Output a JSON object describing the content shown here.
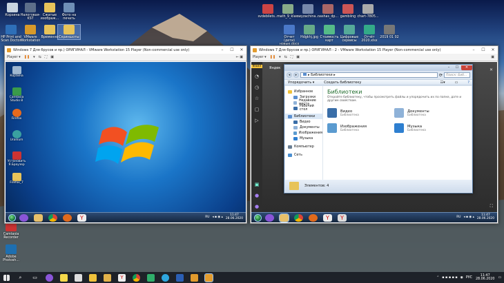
{
  "desktop": {
    "top_left": [
      {
        "label": "Корзина",
        "color": "#c8d4e0"
      },
      {
        "label": "Налоговая-KST",
        "color": "#5d6f8a"
      },
      {
        "label": "Сжатые изображ...",
        "color": "#e7c35a"
      },
      {
        "label": "Фото на печать",
        "color": "#6f8fb6"
      },
      {
        "label": "HP Print and Scan Doctor",
        "color": "#2e6fb8"
      },
      {
        "label": "VMware Workstation",
        "color": "#d89a2a"
      },
      {
        "label": "Временно",
        "color": "#e7c35a"
      },
      {
        "label": "Скриншоты",
        "color": "#e7c35a"
      }
    ],
    "top_right": [
      {
        "label": "svdebilets...",
        "color": "#c44"
      },
      {
        "label": "math_9_klas...",
        "color": "#8a8"
      },
      {
        "label": "neyzachina...",
        "color": "#78a"
      },
      {
        "label": "nashas_dp...",
        "color": "#a66"
      },
      {
        "label": "gambiing",
        "color": "#c55"
      },
      {
        "label": "chart-7805...",
        "color": "#aaa"
      },
      {
        "label": "Отчет (дети) новые.docx",
        "color": "#4a78c8"
      },
      {
        "label": "Hdgkhj.jpg",
        "color": "#6a8"
      },
      {
        "label": "Стоимость карт",
        "color": "#5b8"
      },
      {
        "label": "Цифровые сервисы",
        "color": "#5a9"
      },
      {
        "label": "Отчёт 2020.xlsx",
        "color": "#3a8"
      },
      {
        "label": "2019 01 02",
        "color": "#777"
      }
    ],
    "bottom_left": [
      {
        "label": "Camtasia Recorder",
        "color": "#c33"
      },
      {
        "label": "Adobe Photosh...",
        "color": "#1e6fb0"
      }
    ]
  },
  "vm_left": {
    "title": "Windows 7 Для брусов и пр.) ОРИГИНАЛ - VMware Workstation 15 Player (Non-commercial use only)",
    "player_menu": "Player ▾",
    "guest_icons": [
      {
        "label": "Корзина",
        "color": "#9fb8d0"
      },
      {
        "label": "Camtasia Studio 8",
        "color": "#3a9b4a"
      },
      {
        "label": "Firefox",
        "color": "#e86a1c"
      },
      {
        "label": "Uranium",
        "color": "#3aa0a0"
      },
      {
        "label": "Установить Я.Браузер",
        "color": "#c33"
      },
      {
        "label": "Firefox_7",
        "color": "#e7c35a"
      }
    ],
    "taskbar_icons": [
      {
        "name": "purple-icon",
        "color": "#8a55d8"
      },
      {
        "name": "explorer-icon",
        "color": "#e8c06a"
      },
      {
        "name": "chrome-icon",
        "color": "#e0a23a"
      },
      {
        "name": "firefox-icon",
        "color": "#e06a1c"
      },
      {
        "name": "yandex-icon",
        "color": "#eeeeee"
      }
    ],
    "lang": "RU",
    "time": "11:47",
    "date": "28.06.2020"
  },
  "vm_right": {
    "title": "Windows 7 Для брусов и пр.) ОРИГИНАЛ - 2 - VMware Workstation 15 Player (Non-commercial use only)",
    "player_menu": "Player ▾",
    "browser_label": "Яндек",
    "lang": "RU",
    "time": "11:47",
    "date": "28.06.2020",
    "explorer": {
      "address": "▸ Библиотеки ▸",
      "search_placeholder": "Поиск: Биб...",
      "cmd_organize": "Упорядочить ▾",
      "cmd_new_library": "Создать библиотеку",
      "nav": {
        "favorites": "Избранное",
        "downloads": "Загрузки",
        "recent": "Недавние места",
        "desktop": "Рабочий стол",
        "libraries": "Библиотеки",
        "video": "Видео",
        "documents": "Документы",
        "images": "Изображения",
        "music": "Музыка",
        "computer": "Компьютер",
        "network": "Сеть"
      },
      "heading": "Библиотеки",
      "description": "Откройте библиотеку, чтобы просмотреть файлы и упорядочить их по папке, дате и другим свойствам.",
      "libraries": [
        {
          "name": "Видео",
          "type": "Библиотека",
          "color": "#3a6ea8"
        },
        {
          "name": "Документы",
          "type": "Библиотека",
          "color": "#8fb2d8"
        },
        {
          "name": "Изображения",
          "type": "Библиотека",
          "color": "#5b9bd0"
        },
        {
          "name": "Музыка",
          "type": "Библиотека",
          "color": "#2e7fd0"
        }
      ],
      "status": "Элементов: 4"
    },
    "taskbar_icons": [
      {
        "name": "purple-icon",
        "color": "#8a55d8"
      },
      {
        "name": "explorer-icon",
        "color": "#e8c06a"
      },
      {
        "name": "chrome-icon",
        "color": "#e0a23a"
      },
      {
        "name": "firefox-icon",
        "color": "#e06a1c"
      },
      {
        "name": "yandex-icon",
        "color": "#eeeeee"
      },
      {
        "name": "yandex-browser-icon",
        "color": "#dddddd"
      }
    ]
  },
  "host_taskbar": {
    "lang": "РУС",
    "time": "11:47",
    "date": "28.06.2020"
  }
}
